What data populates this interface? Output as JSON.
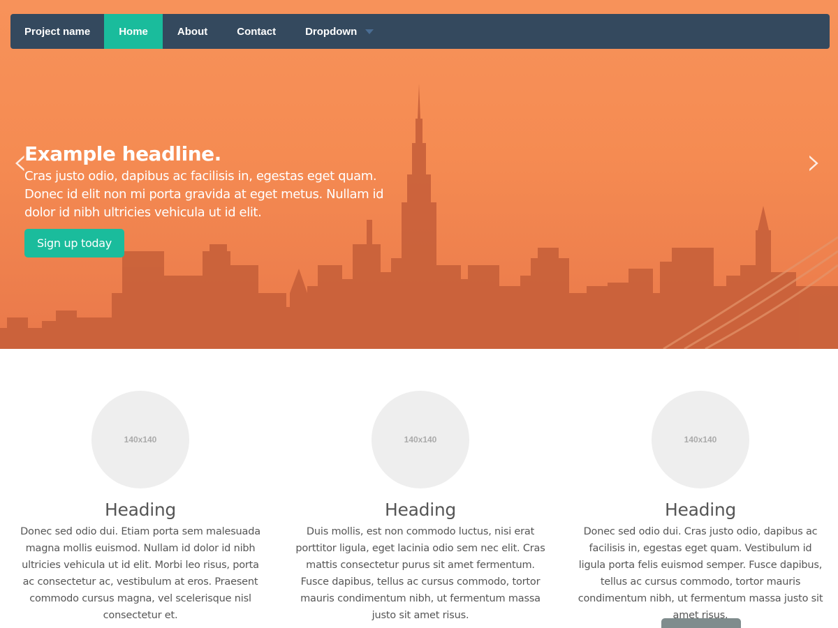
{
  "navbar": {
    "brand": "Project name",
    "items": [
      {
        "label": "Home",
        "active": true
      },
      {
        "label": "About",
        "active": false
      },
      {
        "label": "Contact",
        "active": false
      },
      {
        "label": "Dropdown",
        "active": false
      }
    ]
  },
  "carousel": {
    "headline": "Example headline.",
    "text": "Cras justo odio, dapibus ac facilisis in, egestas eget quam. Donec id elit non mi porta gravida at eget metus. Nullam id dolor id nibh ultricies vehicula ut id elit.",
    "button_label": "Sign up today",
    "prev_glyph": "‹",
    "next_glyph": "›"
  },
  "marketing": [
    {
      "image_label": "140x140",
      "heading": "Heading",
      "text": "Donec sed odio dui. Etiam porta sem malesuada magna mollis euismod. Nullam id dolor id nibh ultricies vehicula ut id elit. Morbi leo risus, porta ac consectetur ac, vestibulum at eros. Praesent commodo cursus magna, vel scelerisque nisl consectetur et."
    },
    {
      "image_label": "140x140",
      "heading": "Heading",
      "text": "Duis mollis, est non commodo luctus, nisi erat porttitor ligula, eget lacinia odio sem nec elit. Cras mattis consectetur purus sit amet fermentum. Fusce dapibus, tellus ac cursus commodo, tortor mauris condimentum nibh, ut fermentum massa justo sit amet risus."
    },
    {
      "image_label": "140x140",
      "heading": "Heading",
      "text": "Donec sed odio dui. Cras justo odio, dapibus ac facilisis in, egestas eget quam. Vestibulum id ligula porta felis euismod semper. Fusce dapibus, tellus ac cursus commodo, tortor mauris condimentum nibh, ut fermentum massa justo sit amet risus."
    }
  ],
  "colors": {
    "navbar_bg": "#34495e",
    "accent": "#1abc9c",
    "hero_orange": "#f58b52",
    "placeholder_bg": "#eeeeee",
    "button_grey": "#7f8c8d"
  },
  "icons": {
    "dropdown": "caret-down-icon",
    "prev": "chevron-left-icon",
    "next": "chevron-right-icon"
  }
}
